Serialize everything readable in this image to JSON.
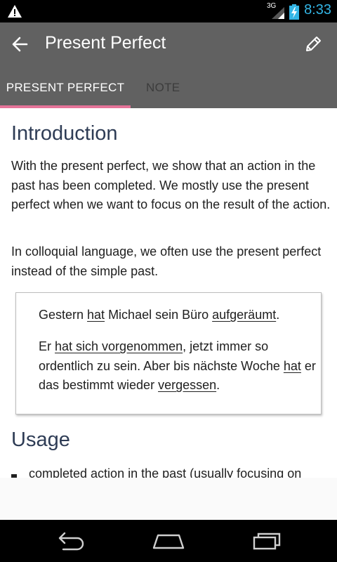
{
  "status_bar": {
    "time": "8:33",
    "network": "3G",
    "icons": [
      "warning-icon",
      "signal-icon",
      "battery-charging-icon"
    ],
    "accent_color": "#33b5e5"
  },
  "app_bar": {
    "title": "Present Perfect",
    "icons": [
      "back-arrow-icon",
      "edit-pencil-icon"
    ],
    "background": "#616161"
  },
  "tabs": [
    {
      "label": "PRESENT PERFECT",
      "active": true
    },
    {
      "label": "NOTE",
      "active": false
    }
  ],
  "tab_indicator_color": "#e57398",
  "content": {
    "heading_intro": "Introduction",
    "para1": "With the present perfect, we show that an action in the past has been completed. We mostly use the present perfect when we want to focus on the result of the action.",
    "para2": "In colloquial language, we often use the present perfect instead of the simple past.",
    "example": {
      "s1_a": "Gestern ",
      "s1_b": "hat",
      "s1_c": " Michael sein Büro ",
      "s1_d": "aufgeräumt",
      "s1_e": ".",
      "s2_a": "Er ",
      "s2_b": "hat sich vorgenommen",
      "s2_c": ", jetzt immer so ordentlich zu sein. Aber bis nächste Woche ",
      "s2_d": "hat",
      "s2_e": " er das bestimmt wieder ",
      "s2_f": "vergessen",
      "s2_g": "."
    },
    "heading_usage": "Usage",
    "bullet1": "completed action in the past (usually focusing on"
  },
  "nav_bar": {
    "icons": [
      "back-nav-icon",
      "home-nav-icon",
      "recents-nav-icon"
    ]
  }
}
